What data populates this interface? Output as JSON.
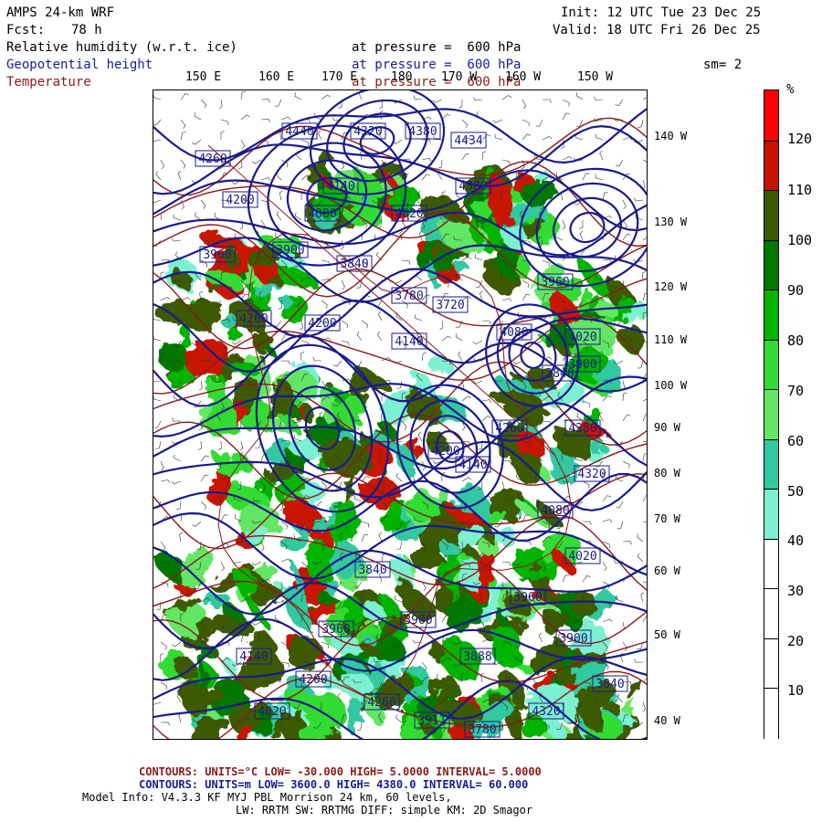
{
  "header": {
    "model": "AMPS 24-km WRF",
    "fcst_label": "Fcst:",
    "fcst_value": "78 h",
    "init": "Init: 12 UTC Tue 23 Dec 25",
    "valid": "Valid: 18 UTC Fri 26 Dec 25",
    "field1": "Relative humidity (w.r.t. ice)",
    "field1_level": "at pressure =  600 hPa",
    "field2": "Geopotential height",
    "field2_level": "at pressure =  600 hPa",
    "sm": "sm= 2",
    "field3": "Temperature",
    "field3_level": "at pressure =  600 hPa"
  },
  "map": {
    "lon_labels": [
      "150 E",
      "160 E",
      "170 E",
      "180",
      "170 W",
      "160 W",
      "150 W"
    ],
    "lat_labels": [
      "140 W",
      "130 W",
      "120 W",
      "110 W",
      "100 W",
      "90 W",
      "80 W",
      "70 W",
      "60 W",
      "50 W",
      "40 W"
    ],
    "height_labels": [
      "4440",
      "4320",
      "4380",
      "4434",
      "4380",
      "4260",
      "4200",
      "4140",
      "4080",
      "4020",
      "3960",
      "3900",
      "3840",
      "3780",
      "3720",
      "4260",
      "4200",
      "4140",
      "4080",
      "4020",
      "3960",
      "3900",
      "3840",
      "4380",
      "4320",
      "4260",
      "4200",
      "4140",
      "4080",
      "4020",
      "3960",
      "3900",
      "3840",
      "3780",
      "3911",
      "3888",
      "4320",
      "4260",
      "4200",
      "4140",
      "4080",
      "4020",
      "3960",
      "3900",
      "3840"
    ],
    "colors": {
      "height_contour": "#1a1a8c",
      "temp_contour": "#8b1a1a",
      "land": "#ffffff"
    }
  },
  "colorbar": {
    "unit": "%",
    "ticks": [
      "120",
      "110",
      "100",
      "90",
      "80",
      "70",
      "60",
      "50",
      "40",
      "30",
      "20",
      "10"
    ],
    "colors": [
      "#ff0000",
      "#c81400",
      "#3c5a00",
      "#007800",
      "#00b400",
      "#32dc32",
      "#64e664",
      "#32c8a0",
      "#7cf0d0",
      "#ffffff",
      "#ffffff",
      "#ffffff",
      "#ffffff"
    ]
  },
  "footer": {
    "line1_label": "CONTOURS:",
    "line1_units": "UNITS=°C",
    "line1_low": "LOW= -30.000",
    "line1_high": "HIGH=  5.0000",
    "line1_interval": "INTERVAL=  5.0000",
    "line2_label": "CONTOURS:",
    "line2_units": "UNITS=m",
    "line2_low": "LOW=  3600.0",
    "line2_high": "HIGH=  4380.0",
    "line2_interval": "INTERVAL=  60.000",
    "line3": "Model Info: V4.3.3   KF      MYJ PBL  Morrison          24 km,   60 levels,",
    "line4": "LW: RRTM SW: RRTMG   DIFF: simple KM: 2D Smagor"
  }
}
